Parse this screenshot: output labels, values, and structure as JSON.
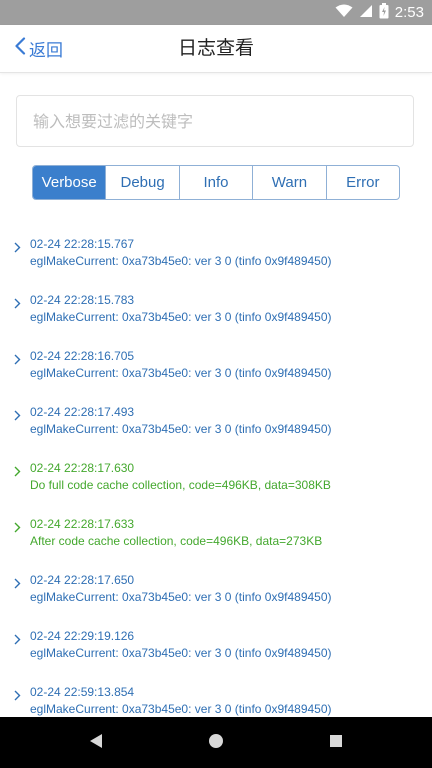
{
  "status_bar": {
    "time": "2:53",
    "icons": [
      "wifi-icon",
      "signal-icon",
      "battery-icon"
    ]
  },
  "header": {
    "back_label": "返回",
    "title": "日志查看"
  },
  "search": {
    "placeholder": "输入想要过滤的关键字",
    "value": ""
  },
  "levels": [
    {
      "label": "Verbose",
      "active": true
    },
    {
      "label": "Debug",
      "active": false
    },
    {
      "label": "Info",
      "active": false
    },
    {
      "label": "Warn",
      "active": false
    },
    {
      "label": "Error",
      "active": false
    }
  ],
  "logs": [
    {
      "time": "02-24  22:28:15.767",
      "message": "eglMakeCurrent: 0xa73b45e0: ver 3 0 (tinfo 0x9f489450)",
      "level": "verbose"
    },
    {
      "time": "02-24  22:28:15.783",
      "message": "eglMakeCurrent: 0xa73b45e0: ver 3 0 (tinfo 0x9f489450)",
      "level": "verbose"
    },
    {
      "time": "02-24  22:28:16.705",
      "message": "eglMakeCurrent: 0xa73b45e0: ver 3 0 (tinfo 0x9f489450)",
      "level": "verbose"
    },
    {
      "time": "02-24  22:28:17.493",
      "message": "eglMakeCurrent: 0xa73b45e0: ver 3 0 (tinfo 0x9f489450)",
      "level": "verbose"
    },
    {
      "time": "02-24  22:28:17.630",
      "message": "Do full code cache collection, code=496KB, data=308KB",
      "level": "info"
    },
    {
      "time": "02-24  22:28:17.633",
      "message": "After code cache collection, code=496KB, data=273KB",
      "level": "info"
    },
    {
      "time": "02-24  22:28:17.650",
      "message": "eglMakeCurrent: 0xa73b45e0: ver 3 0 (tinfo 0x9f489450)",
      "level": "verbose"
    },
    {
      "time": "02-24  22:29:19.126",
      "message": "eglMakeCurrent: 0xa73b45e0: ver 3 0 (tinfo 0x9f489450)",
      "level": "verbose"
    },
    {
      "time": "02-24  22:59:13.854",
      "message": "eglMakeCurrent: 0xa73b45e0: ver 3 0 (tinfo 0x9f489450)",
      "level": "verbose"
    }
  ],
  "colors": {
    "accent": "#3b7fcc",
    "verbose_text": "#2f6fb4",
    "info_text": "#44a82e",
    "status_bar": "#9e9e9e"
  }
}
